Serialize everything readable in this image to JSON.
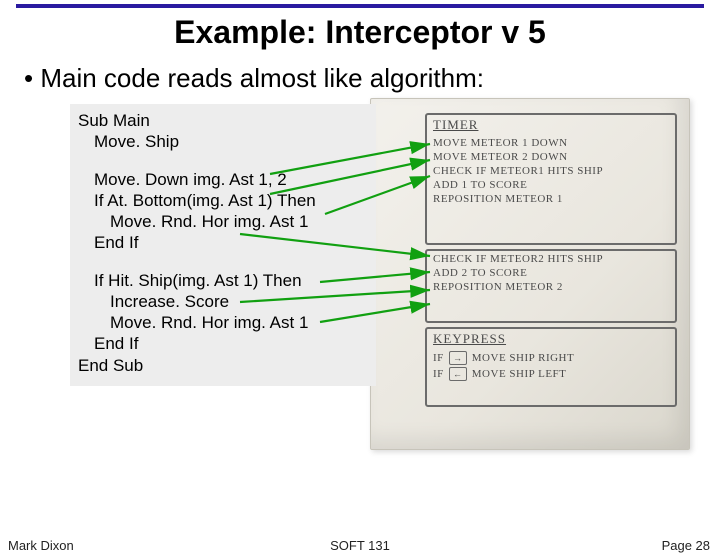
{
  "title": "Example: Interceptor v 5",
  "bullet": "• Main code reads almost like algorithm:",
  "code": {
    "l1": "Sub Main",
    "l2": "Move. Ship",
    "l3": "Move. Down img. Ast 1, 2",
    "l4": "If At. Bottom(img. Ast 1) Then",
    "l5": "Move. Rnd. Hor img. Ast 1",
    "l6": "End If",
    "l7": "If Hit. Ship(img. Ast 1) Then",
    "l8": "Increase. Score",
    "l9": "Move. Rnd. Hor img. Ast 1",
    "l10": "End If",
    "l11": "End Sub"
  },
  "notes": {
    "block1_title": "TIMER",
    "b1l1": "MOVE METEOR 1  DOWN",
    "b1l2": "MOVE METEOR 2  DOWN",
    "b1l3": "CHECK IF METEOR1 HITS SHIP",
    "b1l4": "ADD 1 TO SCORE",
    "b1l5": "REPOSITION METEOR 1",
    "b2l1": "CHECK IF METEOR2 HITS SHIP",
    "b2l2": "ADD 2 TO SCORE",
    "b2l3": "REPOSITION METEOR 2",
    "block3_title": "KEYPRESS",
    "b3l1_pre": "IF",
    "b3l1_key": "→",
    "b3l1_post": "MOVE SHIP RIGHT",
    "b3l2_pre": "IF",
    "b3l2_key": "←",
    "b3l2_post": "MOVE SHIP LEFT"
  },
  "footer": {
    "left": "Mark Dixon",
    "center": "SOFT 131",
    "right": "Page 28"
  }
}
